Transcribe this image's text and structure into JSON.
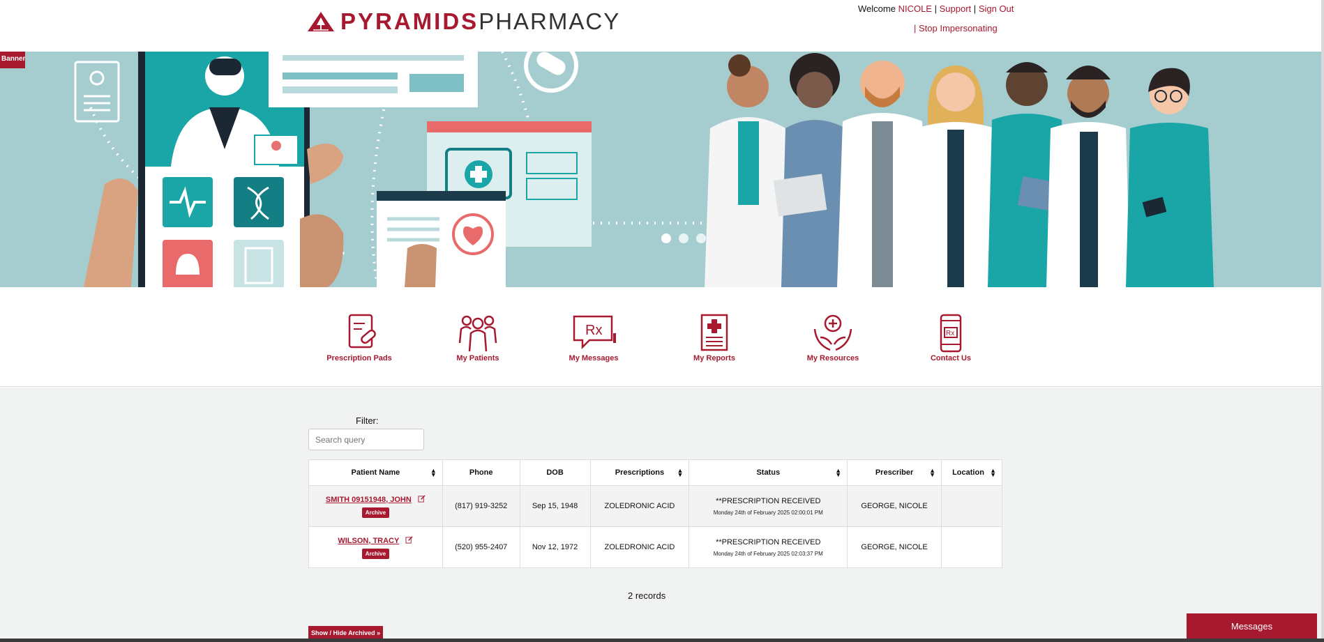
{
  "header": {
    "brand_primary": "PYRAMIDS",
    "brand_secondary": "PHARMACY",
    "welcome_text": "Welcome",
    "user_name": "NICOLE",
    "support_link": "Support",
    "signout_link": "Sign Out",
    "stop_impersonating": "| Stop Impersonating"
  },
  "banner": {
    "tag_label": "Banner »"
  },
  "quick_nav": [
    {
      "label": "Prescription Pads",
      "icon": "prescription-pad-icon"
    },
    {
      "label": "My Patients",
      "icon": "patients-icon"
    },
    {
      "label": "My Messages",
      "icon": "rx-message-icon"
    },
    {
      "label": "My Reports",
      "icon": "report-icon"
    },
    {
      "label": "My Resources",
      "icon": "resources-icon"
    },
    {
      "label": "Contact Us",
      "icon": "phone-icon"
    }
  ],
  "filter": {
    "label": "Filter:",
    "placeholder": "Search query"
  },
  "table": {
    "columns": [
      "Patient Name",
      "Phone",
      "DOB",
      "Prescriptions",
      "Status",
      "Prescriber",
      "Location"
    ],
    "rows": [
      {
        "patient": "SMITH 09151948, JOHN",
        "archive": "Archive",
        "phone": "(817) 919-3252",
        "dob": "Sep 15, 1948",
        "prescriptions": "ZOLEDRONIC ACID",
        "status": "**PRESCRIPTION RECEIVED",
        "status_time": "Monday 24th of February 2025 02:00:01 PM",
        "prescriber": "GEORGE, NICOLE",
        "location": ""
      },
      {
        "patient": "WILSON, TRACY",
        "archive": "Archive",
        "phone": "(520) 955-2407",
        "dob": "Nov 12, 1972",
        "prescriptions": "ZOLEDRONIC ACID",
        "status": "**PRESCRIPTION RECEIVED",
        "status_time": "Monday 24th of February 2025 02:03:37 PM",
        "prescriber": "GEORGE, NICOLE",
        "location": ""
      }
    ]
  },
  "records_count": "2 records",
  "toggle_archived": "Show / Hide Archived »",
  "messages_button": "Messages",
  "colors": {
    "brand": "#a6192e",
    "banner_bg": "#a5cdd0",
    "teal": "#1aa6a6",
    "content_bg": "#f1f2f2"
  }
}
